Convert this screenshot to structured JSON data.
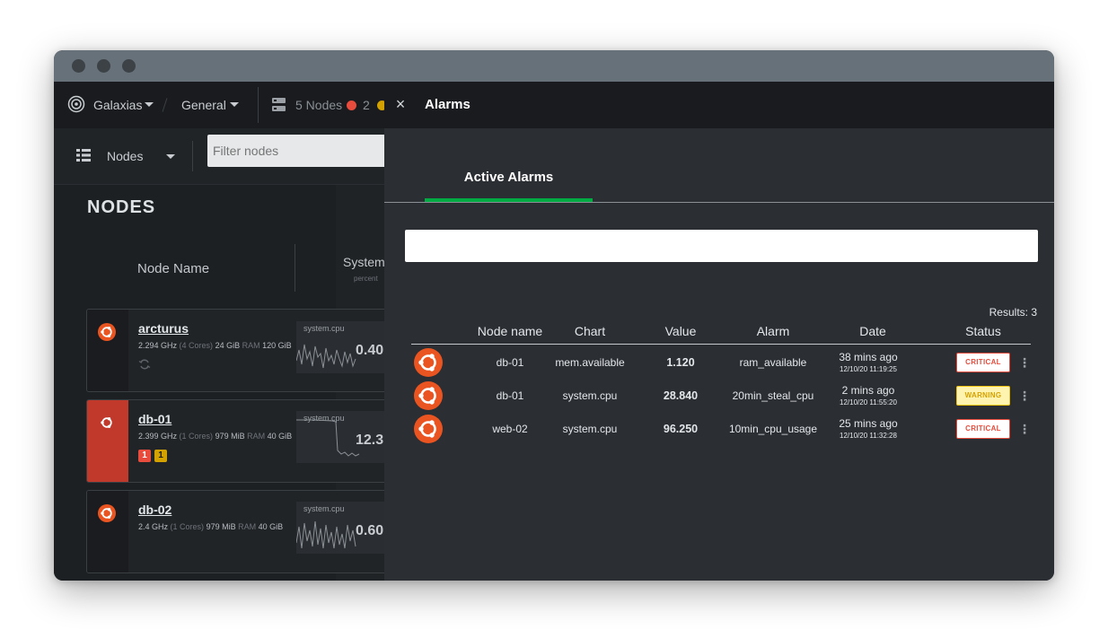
{
  "topbar": {
    "space": "Galaxias",
    "room": "General",
    "nodes_count": "5 Nodes",
    "critical_count": "2",
    "critical_color": "#e74c3c",
    "warning_color": "#d4a200"
  },
  "left": {
    "view_label": "Nodes",
    "filter_placeholder": "Filter nodes",
    "section_title": "NODES",
    "col_node_name": "Node Name",
    "col_system": "System",
    "col_system_sub": "percent",
    "cards": [
      {
        "name": "arcturus",
        "ghz": "2.294 GHz",
        "cores": "(4 Cores)",
        "ram": "24 GiB",
        "ram_label": "RAM",
        "disk": "120 GiB",
        "chart": "system.cpu",
        "value": "0.40"
      },
      {
        "name": "db-01",
        "ghz": "2.399 GHz",
        "cores": "(1 Cores)",
        "ram": "979 MiB",
        "ram_label": "RAM",
        "disk": "40 GiB",
        "chart": "system.cpu",
        "value": "12.3",
        "badge_critical": "1",
        "badge_warning": "1"
      },
      {
        "name": "db-02",
        "ghz": "2.4 GHz",
        "cores": "(1 Cores)",
        "ram": "979 MiB",
        "ram_label": "RAM",
        "disk": "40 GiB",
        "chart": "system.cpu",
        "value": "0.60"
      }
    ]
  },
  "panel": {
    "close": "×",
    "title": "Alarms",
    "tab": "Active Alarms",
    "search_value": "",
    "results": "Results: 3",
    "columns": [
      "Node name",
      "Chart",
      "Value",
      "Alarm",
      "Date",
      "Status"
    ],
    "rows": [
      {
        "node": "db-01",
        "chart": "mem.available",
        "value": "1.120",
        "alarm": "ram_available",
        "date": "38 mins ago",
        "date_full": "12/10/20 11:19:25",
        "status": "CRITICAL",
        "status_kind": "critical"
      },
      {
        "node": "db-01",
        "chart": "system.cpu",
        "value": "28.840",
        "alarm": "20min_steal_cpu",
        "date": "2 mins ago",
        "date_full": "12/10/20 11:55:20",
        "status": "WARNING",
        "status_kind": "warning"
      },
      {
        "node": "web-02",
        "chart": "system.cpu",
        "value": "96.250",
        "alarm": "10min_cpu_usage",
        "date": "25 mins ago",
        "date_full": "12/10/20 11:32:28",
        "status": "CRITICAL",
        "status_kind": "critical"
      }
    ],
    "kebab": "⋮"
  },
  "colors": {
    "ubuntu": "#e95420",
    "tab_accent": "#00ab44",
    "critical": "#e74c3c",
    "warning": "#f1c40f"
  }
}
